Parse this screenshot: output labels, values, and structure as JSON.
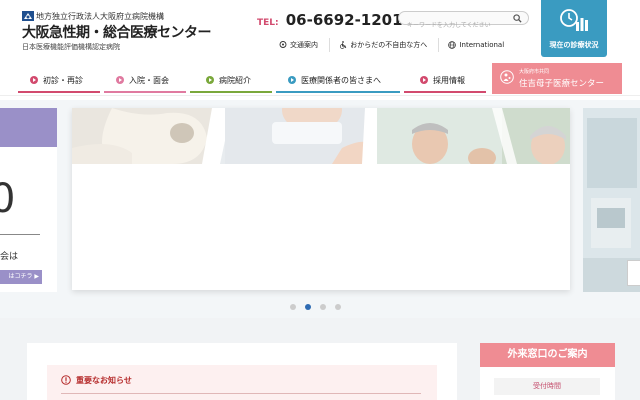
{
  "header": {
    "org_label": "地方独立行政法人大阪府立病院機構",
    "hospital_name": "大阪急性期・総合医療センター",
    "certification": "日本医療機能評価機構認定病院",
    "tel_label": "TEL:",
    "tel_number": "06-6692-1201",
    "search_placeholder": "キーワードを入力してください",
    "util_links": [
      {
        "label": "交通案内",
        "icon": "map-pin-icon"
      },
      {
        "label": "おからだの不自由な方へ",
        "icon": "wheelchair-icon"
      },
      {
        "label": "International",
        "icon": "globe-icon"
      }
    ],
    "status_button_label": "現在の診療状況"
  },
  "nav": {
    "items": [
      {
        "label": "初診・再診",
        "color": "#d24a6e"
      },
      {
        "label": "入院・面会",
        "color": "#e07aa0"
      },
      {
        "label": "病院紹介",
        "color": "#7aa83b"
      },
      {
        "label": "医療関係者の皆さまへ",
        "color": "#3a9bc1"
      },
      {
        "label": "採用情報",
        "color": "#d24a6e"
      }
    ],
    "sumiyoshi_sub": "大阪府市共同",
    "sumiyoshi_title": "住吉母子医療センター"
  },
  "slider": {
    "left_digit": "0",
    "left_text": "会は",
    "left_button": "はコチラ",
    "active_dot": 1,
    "dot_count": 4
  },
  "notice": {
    "title": "重要なお知らせ"
  },
  "outpatient": {
    "title": "外来窓口のご案内",
    "hours_label": "受付時間"
  },
  "colors": {
    "accent_blue": "#3a9bc1",
    "accent_pink": "#ef8c93",
    "accent_purple": "#9a90c8",
    "notice_red": "#b62d2d"
  }
}
